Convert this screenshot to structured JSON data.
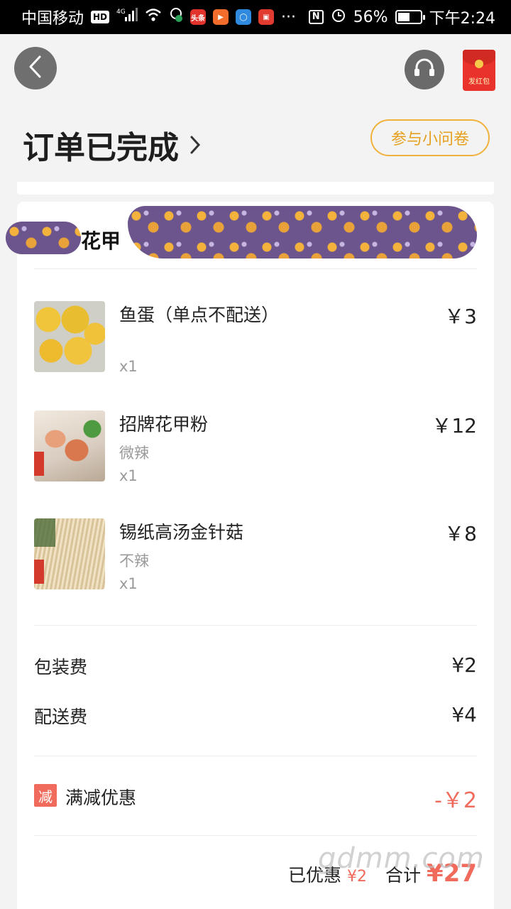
{
  "status_bar": {
    "carrier": "中国移动",
    "hd_label": "HD",
    "network_label": "4G",
    "app_toutiao": "头条",
    "more": "···",
    "nfc": "N",
    "battery_percent": "56%",
    "battery_level": 0.56,
    "time": "下午2:24"
  },
  "header": {
    "redpack_label": "发红包",
    "order_status": "订单已完成",
    "survey_label": "参与小问卷"
  },
  "shop": {
    "name": "花甲"
  },
  "items": [
    {
      "name": "鱼蛋（单点不配送）",
      "spec": "",
      "qty": "x1",
      "price": "￥3"
    },
    {
      "name": "招牌花甲粉",
      "spec": "微辣",
      "qty": "x1",
      "price": "￥12"
    },
    {
      "name": "锡纸高汤金针菇",
      "spec": "不辣",
      "qty": "x1",
      "price": "￥8"
    }
  ],
  "fees": {
    "packing_label": "包装费",
    "packing_value": "¥2",
    "delivery_label": "配送费",
    "delivery_value": "¥4"
  },
  "discount": {
    "tag": "减",
    "label": "满减优惠",
    "value": "-￥2"
  },
  "summary": {
    "saved_label": "已优惠",
    "saved_value": "¥2",
    "total_label": "合计",
    "total_value": "¥27"
  },
  "watermark": "gdmm.com",
  "colors": {
    "accent_orange": "#f0b23c",
    "discount_red": "#f06b5b"
  }
}
